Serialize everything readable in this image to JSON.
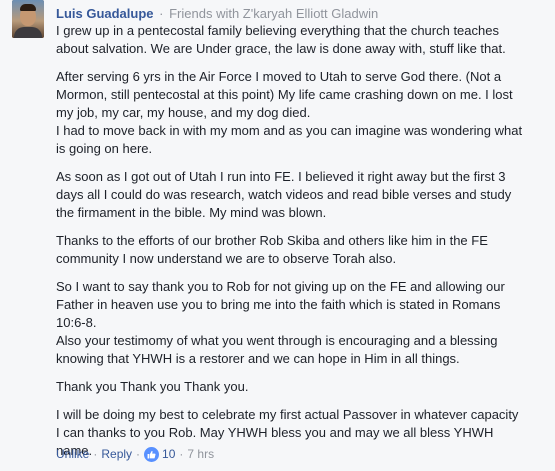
{
  "comment": {
    "author": "Luis Guadalupe",
    "context": "Friends with Z'karyah Elliott Gladwin",
    "paragraphs": [
      [
        "I grew up in a pentecostal family believing everything that the church teaches",
        "about salvation. We are Under grace, the law is done away with, stuff like that."
      ],
      [
        "After serving 6 yrs in the Air Force I moved to Utah to serve God there. (Not a",
        "Mormon, still pentecostal at this point) My life came crashing down on me. I lost",
        "my job, my car, my house, and my dog died.",
        "I had to move back in with my mom and as you can imagine was wondering what",
        "is going on here."
      ],
      [
        "As soon as I got out of Utah I run into FE. I believed it right away but the first 3",
        "days all I could do was research, watch videos and read bible verses and study",
        "the firmament in the bible. My mind was blown."
      ],
      [
        "Thanks to the efforts of our brother Rob Skiba and others like him in the FE",
        "community I now understand we are to observe Torah also."
      ],
      [
        "So I want to say thank you to Rob for not giving up on the FE and allowing our",
        "Father in heaven use you to bring me into the faith which is stated in Romans",
        "10:6-8.",
        "Also your testimomy of what you went through is encouraging and a blessing",
        "knowing that YHWH is a restorer and we can hope in Him in all things."
      ],
      [
        "Thank you Thank you Thank you."
      ],
      [
        "I will be doing my best to celebrate my first actual Passover in whatever capacity",
        "I can thanks to you Rob. May YHWH bless you and may we all bless YHWH",
        "name."
      ]
    ],
    "actions": {
      "unlike": "Unlike",
      "reply": "Reply",
      "like_count": "10",
      "time": "7 hrs"
    },
    "colors": {
      "link": "#365899",
      "meta": "#90949c",
      "text": "#1d2129",
      "like_badge": "#5890ff"
    },
    "icons": {
      "avatar": "profile-photo",
      "like": "thumbs-up-icon"
    }
  }
}
